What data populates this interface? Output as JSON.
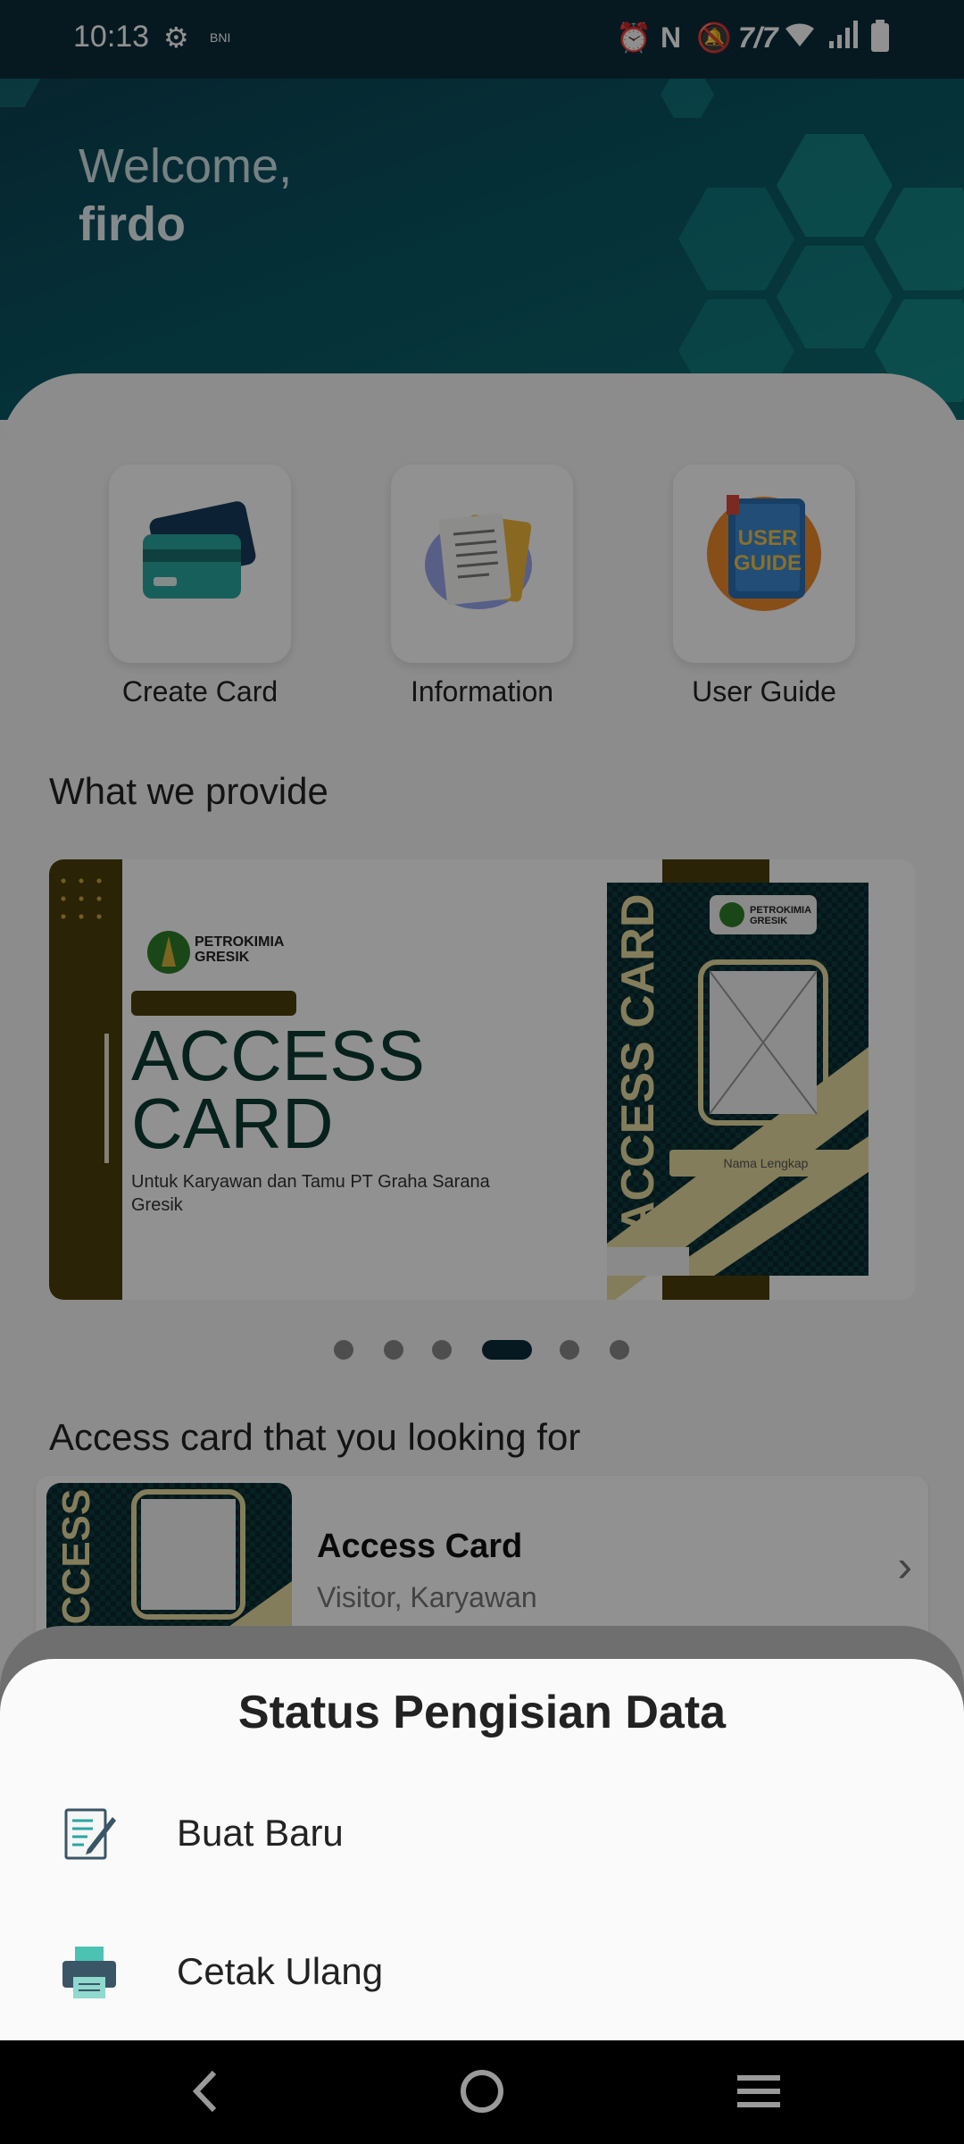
{
  "status_bar": {
    "time": "10:13",
    "carrier_label": "BNI",
    "icons": [
      "settings-gear-icon",
      "alarm-icon",
      "nfc-icon",
      "silent-icon",
      "vowifi-icon",
      "wifi-icon",
      "signal-icon",
      "battery-icon"
    ]
  },
  "header": {
    "welcome": "Welcome,",
    "username": "firdo"
  },
  "menu": [
    {
      "label": "Create Card",
      "icon": "credit-card-icon"
    },
    {
      "label": "Information",
      "icon": "document-icon"
    },
    {
      "label": "User Guide",
      "icon": "user-guide-book-icon"
    }
  ],
  "provide": {
    "title": "What we provide",
    "banner": {
      "logo_text_line1": "PETROKIMIA",
      "logo_text_line2": "GRESIK",
      "heading_line1": "ACCESS",
      "heading_line2": "CARD",
      "subtitle": "Untuk Karyawan dan Tamu PT Graha Sarana Gresik",
      "card_vertical_text": "ACCESS CARD",
      "card_name_placeholder": "Nama Lengkap"
    },
    "carousel": {
      "count": 6,
      "active_index": 3
    }
  },
  "looking": {
    "title": "Access card that you looking for",
    "item": {
      "name": "Access Card",
      "subtitle": "Visitor, Karyawan"
    }
  },
  "bottom_sheet": {
    "title": "Status Pengisian Data",
    "options": [
      {
        "label": "Buat Baru",
        "icon": "edit-document-icon"
      },
      {
        "label": "Cetak Ulang",
        "icon": "printer-icon"
      }
    ]
  },
  "colors": {
    "header_bg": "#0b4656",
    "accent_dark": "#0b2d3b",
    "card_gold": "#4b3f0a",
    "card_green": "#0d3a32"
  }
}
